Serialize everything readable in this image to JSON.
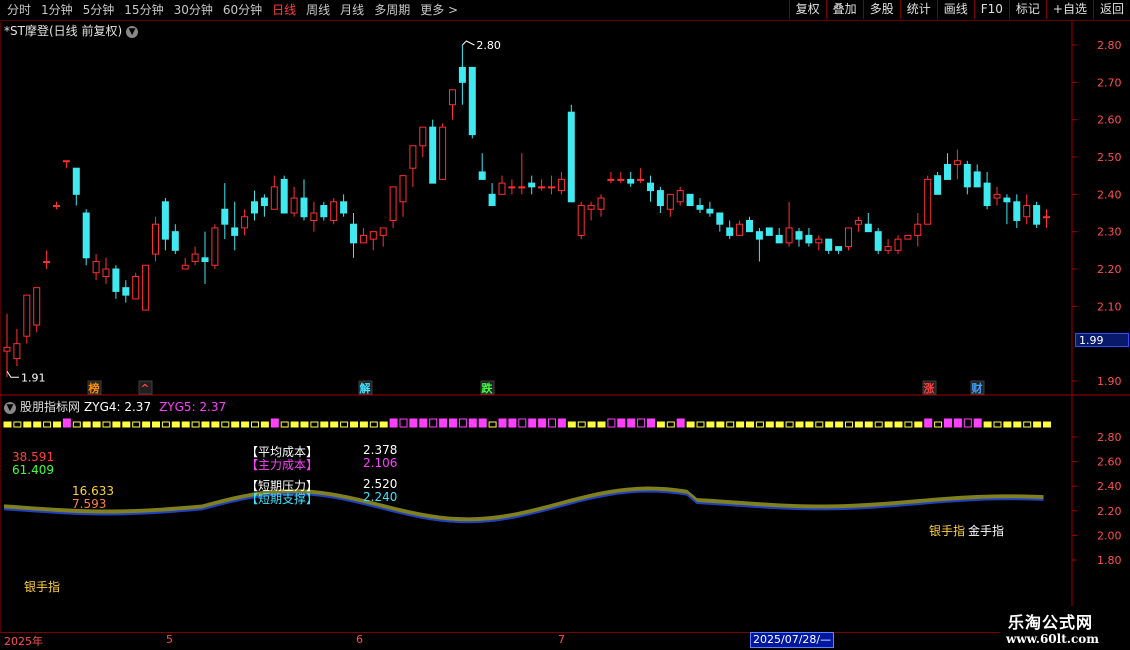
{
  "toolbar": {
    "periods": [
      {
        "label": "分时",
        "active": false
      },
      {
        "label": "1分钟",
        "active": false
      },
      {
        "label": "5分钟",
        "active": false
      },
      {
        "label": "15分钟",
        "active": false
      },
      {
        "label": "30分钟",
        "active": false
      },
      {
        "label": "60分钟",
        "active": false
      },
      {
        "label": "日线",
        "active": true
      },
      {
        "label": "周线",
        "active": false
      },
      {
        "label": "月线",
        "active": false
      },
      {
        "label": "多周期",
        "active": false
      },
      {
        "label": "更多 >",
        "active": false
      }
    ],
    "right_buttons": [
      "复权",
      "叠加",
      "多股",
      "统计",
      "画线",
      "F10",
      "标记",
      "+自选",
      "返回"
    ]
  },
  "main_title": "*ST摩登(日线 前复权)",
  "price_axis": [
    "2.80",
    "2.70",
    "2.60",
    "2.50",
    "2.40",
    "2.30",
    "2.20",
    "2.10",
    "1.90"
  ],
  "current_price": "1.99",
  "high_label": "2.80",
  "low_label": "1.91",
  "event_tags": [
    {
      "text": "榜",
      "color": "#ff9000"
    },
    {
      "text": "^",
      "color": "#ff4040"
    },
    {
      "text": "解",
      "color": "#40e0ff"
    },
    {
      "text": "跌",
      "color": "#40ff40"
    },
    {
      "text": "涨",
      "color": "#ff4040"
    },
    {
      "text": "财",
      "color": "#40a0ff"
    }
  ],
  "indicator": {
    "name": "股朋指标网",
    "zyg4": "ZYG4: 2.37",
    "zyg5": "ZYG5: 2.37",
    "axis": [
      "2.80",
      "2.60",
      "2.40",
      "2.20",
      "2.00",
      "1.80"
    ],
    "left_a": "38.591",
    "left_b": "61.409",
    "mid_a": "16.633",
    "mid_b": "7.593",
    "avg_cost_label": "【平均成本】",
    "avg_cost_value": "2.378",
    "main_cost_label": "【主力成本】",
    "main_cost_value": "2.106",
    "short_press_label": "【短期压力】",
    "short_press_value": "2.520",
    "short_support_label": "【短期支撑】",
    "short_support_value": "2.240",
    "silver_label": "银手指",
    "gold_label": "金手指",
    "silver_label_left": "银手指"
  },
  "dates": {
    "year": "2025年",
    "m5": "5",
    "m6": "6",
    "m7": "7",
    "cursor": "2025/07/28/—"
  },
  "watermark": {
    "line1": "乐淘公式网",
    "line2": "www.60lt.com"
  },
  "chart_data": {
    "type": "candlestick",
    "series": [
      {
        "name": "ohlc",
        "values": [
          [
            1.98,
            2.08,
            1.91,
            1.99
          ],
          [
            1.96,
            2.04,
            1.94,
            2.0
          ],
          [
            2.02,
            2.13,
            2.0,
            2.13
          ],
          [
            2.05,
            2.15,
            2.03,
            2.15
          ],
          [
            2.22,
            2.25,
            2.2,
            2.22
          ],
          [
            2.37,
            2.38,
            2.36,
            2.37
          ],
          [
            2.49,
            2.49,
            2.47,
            2.49
          ],
          [
            2.47,
            2.47,
            2.37,
            2.4
          ],
          [
            2.35,
            2.36,
            2.21,
            2.23
          ],
          [
            2.19,
            2.24,
            2.17,
            2.22
          ],
          [
            2.18,
            2.23,
            2.16,
            2.2
          ],
          [
            2.2,
            2.21,
            2.12,
            2.14
          ],
          [
            2.15,
            2.17,
            2.11,
            2.13
          ],
          [
            2.12,
            2.19,
            2.12,
            2.18
          ],
          [
            2.09,
            2.21,
            2.09,
            2.21
          ],
          [
            2.24,
            2.34,
            2.22,
            2.32
          ],
          [
            2.38,
            2.39,
            2.25,
            2.28
          ],
          [
            2.3,
            2.32,
            2.24,
            2.25
          ],
          [
            2.2,
            2.23,
            2.2,
            2.21
          ],
          [
            2.22,
            2.26,
            2.21,
            2.24
          ],
          [
            2.23,
            2.3,
            2.16,
            2.22
          ],
          [
            2.21,
            2.32,
            2.2,
            2.31
          ],
          [
            2.36,
            2.43,
            2.28,
            2.32
          ],
          [
            2.31,
            2.38,
            2.25,
            2.29
          ],
          [
            2.31,
            2.36,
            2.29,
            2.34
          ],
          [
            2.38,
            2.41,
            2.33,
            2.35
          ],
          [
            2.39,
            2.4,
            2.34,
            2.37
          ],
          [
            2.36,
            2.45,
            2.36,
            2.42
          ],
          [
            2.44,
            2.45,
            2.35,
            2.35
          ],
          [
            2.35,
            2.42,
            2.34,
            2.39
          ],
          [
            2.39,
            2.44,
            2.33,
            2.34
          ],
          [
            2.33,
            2.38,
            2.3,
            2.35
          ],
          [
            2.37,
            2.38,
            2.33,
            2.34
          ],
          [
            2.33,
            2.39,
            2.32,
            2.38
          ],
          [
            2.38,
            2.4,
            2.34,
            2.35
          ],
          [
            2.32,
            2.35,
            2.23,
            2.27
          ],
          [
            2.27,
            2.31,
            2.27,
            2.29
          ],
          [
            2.28,
            2.29,
            2.25,
            2.3
          ],
          [
            2.29,
            2.3,
            2.26,
            2.31
          ],
          [
            2.33,
            2.42,
            2.31,
            2.42
          ],
          [
            2.38,
            2.43,
            2.34,
            2.45
          ],
          [
            2.47,
            2.49,
            2.42,
            2.53
          ],
          [
            2.53,
            2.56,
            2.5,
            2.58
          ],
          [
            2.58,
            2.6,
            2.43,
            2.43
          ],
          [
            2.44,
            2.59,
            2.44,
            2.58
          ],
          [
            2.64,
            2.68,
            2.6,
            2.68
          ],
          [
            2.74,
            2.8,
            2.64,
            2.7
          ],
          [
            2.74,
            2.74,
            2.55,
            2.56
          ],
          [
            2.46,
            2.51,
            2.44,
            2.44
          ],
          [
            2.4,
            2.43,
            2.37,
            2.37
          ],
          [
            2.4,
            2.45,
            2.4,
            2.43
          ],
          [
            2.42,
            2.44,
            2.4,
            2.42
          ],
          [
            2.42,
            2.51,
            2.4,
            2.42
          ],
          [
            2.43,
            2.45,
            2.4,
            2.42
          ],
          [
            2.42,
            2.44,
            2.41,
            2.42
          ],
          [
            2.42,
            2.45,
            2.4,
            2.42
          ],
          [
            2.41,
            2.46,
            2.4,
            2.44
          ],
          [
            2.62,
            2.64,
            2.38,
            2.38
          ],
          [
            2.29,
            2.38,
            2.28,
            2.37
          ],
          [
            2.36,
            2.38,
            2.33,
            2.37
          ],
          [
            2.36,
            2.4,
            2.34,
            2.39
          ],
          [
            2.44,
            2.46,
            2.43,
            2.44
          ],
          [
            2.44,
            2.46,
            2.43,
            2.44
          ],
          [
            2.44,
            2.46,
            2.42,
            2.43
          ],
          [
            2.44,
            2.47,
            2.43,
            2.44
          ],
          [
            2.43,
            2.45,
            2.38,
            2.41
          ],
          [
            2.41,
            2.42,
            2.35,
            2.37
          ],
          [
            2.36,
            2.4,
            2.34,
            2.4
          ],
          [
            2.38,
            2.42,
            2.37,
            2.41
          ],
          [
            2.4,
            2.4,
            2.37,
            2.37
          ],
          [
            2.37,
            2.39,
            2.35,
            2.36
          ],
          [
            2.36,
            2.38,
            2.34,
            2.35
          ],
          [
            2.35,
            2.35,
            2.3,
            2.32
          ],
          [
            2.31,
            2.33,
            2.28,
            2.29
          ],
          [
            2.29,
            2.33,
            2.29,
            2.32
          ],
          [
            2.33,
            2.34,
            2.3,
            2.3
          ],
          [
            2.3,
            2.31,
            2.22,
            2.28
          ],
          [
            2.31,
            2.31,
            2.29,
            2.29
          ],
          [
            2.29,
            2.31,
            2.27,
            2.27
          ],
          [
            2.27,
            2.38,
            2.26,
            2.31
          ],
          [
            2.3,
            2.31,
            2.26,
            2.28
          ],
          [
            2.29,
            2.31,
            2.26,
            2.27
          ],
          [
            2.27,
            2.29,
            2.25,
            2.28
          ],
          [
            2.28,
            2.28,
            2.24,
            2.25
          ],
          [
            2.26,
            2.26,
            2.24,
            2.25
          ],
          [
            2.26,
            2.31,
            2.25,
            2.31
          ],
          [
            2.32,
            2.34,
            2.3,
            2.33
          ],
          [
            2.32,
            2.35,
            2.31,
            2.3
          ],
          [
            2.3,
            2.31,
            2.24,
            2.25
          ],
          [
            2.25,
            2.28,
            2.24,
            2.26
          ],
          [
            2.25,
            2.29,
            2.24,
            2.28
          ],
          [
            2.28,
            2.29,
            2.28,
            2.29
          ],
          [
            2.29,
            2.35,
            2.26,
            2.32
          ],
          [
            2.32,
            2.45,
            2.32,
            2.44
          ],
          [
            2.45,
            2.46,
            2.4,
            2.4
          ],
          [
            2.48,
            2.51,
            2.44,
            2.44
          ],
          [
            2.48,
            2.52,
            2.44,
            2.49
          ],
          [
            2.48,
            2.49,
            2.4,
            2.42
          ],
          [
            2.46,
            2.48,
            2.42,
            2.42
          ],
          [
            2.43,
            2.46,
            2.36,
            2.37
          ],
          [
            2.39,
            2.42,
            2.37,
            2.4
          ],
          [
            2.39,
            2.4,
            2.32,
            2.38
          ],
          [
            2.38,
            2.4,
            2.31,
            2.33
          ],
          [
            2.34,
            2.4,
            2.32,
            2.37
          ],
          [
            2.37,
            2.38,
            2.31,
            2.32
          ],
          [
            2.34,
            2.36,
            2.31,
            2.34
          ]
        ]
      }
    ]
  }
}
